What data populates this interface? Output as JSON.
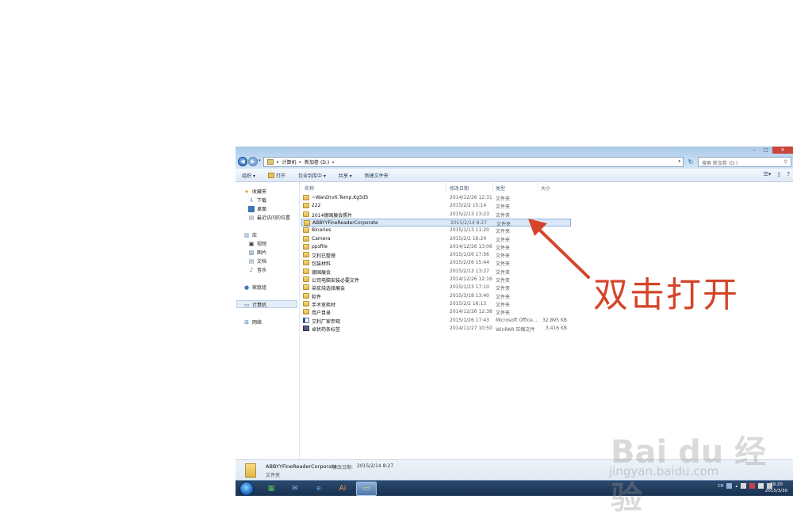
{
  "window": {
    "address": [
      "计算机",
      "新加卷 (D:)"
    ],
    "search_placeholder": "搜索 新加卷 (D:)",
    "controls": {
      "minimize": "–",
      "maximize": "□",
      "close": "✕"
    }
  },
  "toolbar": {
    "organize": "组织 ▾",
    "open": "打开",
    "include_in_library": "包含到库中 ▾",
    "share": "共享 ▾",
    "new_folder": "新建文件夹"
  },
  "sidebar": {
    "favorites": "收藏夹",
    "downloads": "下载",
    "desktop": "桌面",
    "recent": "最近访问的位置",
    "libraries": "库",
    "videos": "视频",
    "pictures": "图片",
    "documents": "文档",
    "music": "音乐",
    "homegroup": "家庭组",
    "computer": "计算机",
    "network": "网络"
  },
  "columns": {
    "name": "名称",
    "date": "修改日期",
    "type": "类型",
    "size": "大小"
  },
  "files": [
    {
      "name": "~WanDrv6.Temp.Kg5d5",
      "date": "2014/12/26 12:31",
      "type": "文件夹",
      "size": "",
      "icon": "folder"
    },
    {
      "name": "222",
      "date": "2015/2/2 15:14",
      "type": "文件夹",
      "size": "",
      "icon": "folder"
    },
    {
      "name": "2014德国展会照片",
      "date": "2015/2/13 13:23",
      "type": "文件夹",
      "size": "",
      "icon": "folder"
    },
    {
      "name": "ABBYYFineReaderCorporate",
      "date": "2015/2/14 8:27",
      "type": "文件夹",
      "size": "",
      "icon": "folder",
      "selected": true
    },
    {
      "name": "Binaries",
      "date": "2015/1/13 11:20",
      "type": "文件夹",
      "size": "",
      "icon": "folder"
    },
    {
      "name": "Camera",
      "date": "2015/2/2 16:20",
      "type": "文件夹",
      "size": "",
      "icon": "folder"
    },
    {
      "name": "ppsfile",
      "date": "2014/12/26 13:06",
      "type": "文件夹",
      "size": "",
      "icon": "folder"
    },
    {
      "name": "艾利已整理",
      "date": "2015/1/26 17:56",
      "type": "文件夹",
      "size": "",
      "icon": "folder"
    },
    {
      "name": "包装材料",
      "date": "2015/2/26 15:44",
      "type": "文件夹",
      "size": "",
      "icon": "folder"
    },
    {
      "name": "德国展会",
      "date": "2015/2/13 13:27",
      "type": "文件夹",
      "size": "",
      "icon": "folder"
    },
    {
      "name": "公司电脑安装必要文件",
      "date": "2014/12/26 12:16",
      "type": "文件夹",
      "size": "",
      "icon": "folder"
    },
    {
      "name": "染浆烧选择展会",
      "date": "2015/1/23 17:10",
      "type": "文件夹",
      "size": "",
      "icon": "folder"
    },
    {
      "name": "软件",
      "date": "2015/3/18 13:40",
      "type": "文件夹",
      "size": "",
      "icon": "folder"
    },
    {
      "name": "手术室耗材",
      "date": "2015/2/2 16:13",
      "type": "文件夹",
      "size": "",
      "icon": "folder"
    },
    {
      "name": "用户目录",
      "date": "2014/12/26 12:38",
      "type": "文件夹",
      "size": "",
      "icon": "folder"
    },
    {
      "name": "艾利厂家参观",
      "date": "2015/1/26 17:43",
      "type": "Microsoft Office...",
      "size": "32,895 KB",
      "icon": "doc"
    },
    {
      "name": "卓状药条标签",
      "date": "2014/11/27 10:50",
      "type": "WinRAR 压缩文件",
      "size": "3,416 KB",
      "icon": "rar"
    }
  ],
  "details": {
    "name": "ABBYYFineReaderCorporate",
    "modified_label": "修改日期:",
    "modified": "2015/2/14 8:27",
    "type": "文件夹"
  },
  "taskbar": {
    "lang": "CH",
    "clock_time": "19:20",
    "clock_date": "2015/3/30"
  },
  "annotation": {
    "text": "双击打开",
    "color": "#d4452a"
  },
  "watermark": {
    "brand": "Bai du 经验",
    "url": "jingyan.baidu.com"
  }
}
